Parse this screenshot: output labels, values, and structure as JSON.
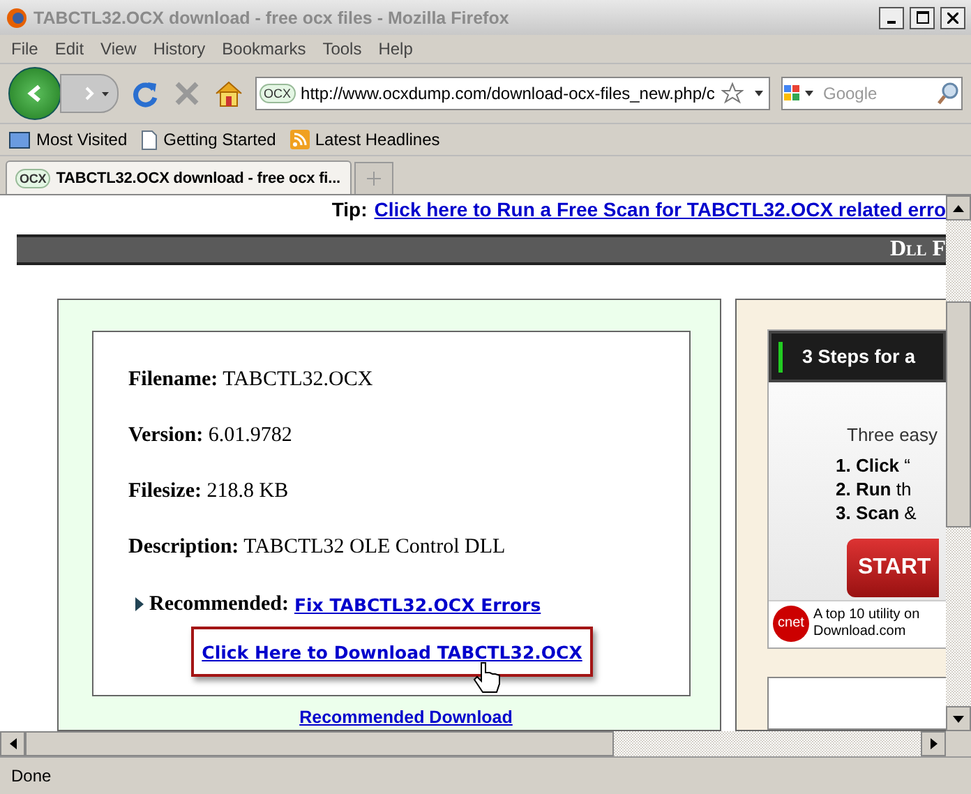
{
  "window": {
    "title": "TABCTL32.OCX download - free ocx files - Mozilla Firefox"
  },
  "menu": [
    "File",
    "Edit",
    "View",
    "History",
    "Bookmarks",
    "Tools",
    "Help"
  ],
  "address": {
    "site_badge": "OCX",
    "value": "http://www.ocxdump.com/download-ocx-files_new.php/c"
  },
  "search": {
    "placeholder": "Google"
  },
  "bookmarks": [
    {
      "label": "Most Visited",
      "kind": "folder"
    },
    {
      "label": "Getting Started",
      "kind": "page"
    },
    {
      "label": "Latest Headlines",
      "kind": "feed"
    }
  ],
  "tabs": [
    {
      "badge": "OCX",
      "label": "TABCTL32.OCX download - free ocx fi...",
      "selected": true
    }
  ],
  "page": {
    "tip_label": "Tip:",
    "tip_link": "Click here to Run a Free Scan for TABCTL32.OCX related erro",
    "banner": "Dll F",
    "fields": [
      {
        "label": "Filename:",
        "value": "TABCTL32.OCX"
      },
      {
        "label": "Version:",
        "value": "6.01.9782"
      },
      {
        "label": "Filesize:",
        "value": "218.8 KB"
      },
      {
        "label": "Description:",
        "value": "TABCTL32 OLE Control DLL"
      }
    ],
    "recommended_label": "Recommended:",
    "recommended_link": "Fix TABCTL32.OCX Errors",
    "download_link": "Click Here to Download TABCTL32.OCX",
    "recommended_download": "Recommended Download",
    "ad": {
      "header": "3 Steps for a",
      "intro": "Three easy",
      "steps": [
        {
          "bold": "1. Click",
          "rest": " “"
        },
        {
          "bold": "2. Run",
          "rest": " th"
        },
        {
          "bold": "3. Scan",
          "rest": " &"
        }
      ],
      "button": "START",
      "badge": "cnet",
      "footer_1": "A top 10 utility on",
      "footer_2": "Download.com"
    }
  },
  "status": "Done"
}
